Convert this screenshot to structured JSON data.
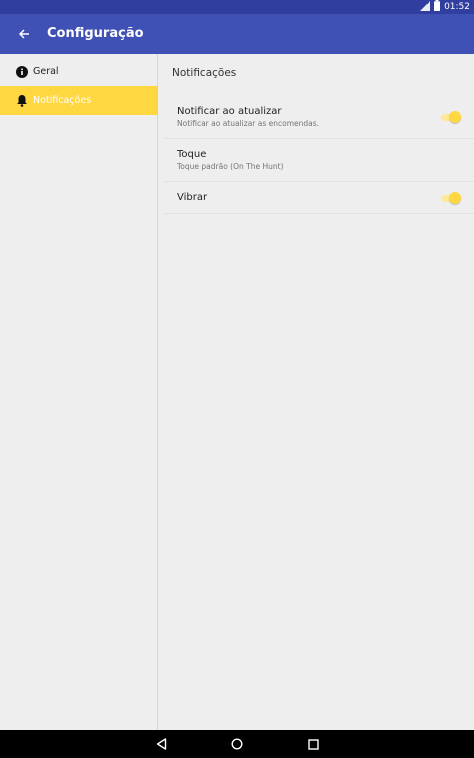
{
  "status_bar": {
    "time": "01:52",
    "icons": [
      "signal-icon",
      "battery-icon"
    ]
  },
  "app_bar": {
    "title": "Configuração",
    "back_icon": "arrow-back-icon"
  },
  "sidebar": {
    "items": [
      {
        "label": "Geral",
        "icon": "info-icon",
        "active": false
      },
      {
        "label": "Notificações",
        "icon": "bell-icon",
        "active": true
      }
    ]
  },
  "panel": {
    "title": "Notificações",
    "preferences": [
      {
        "title": "Notificar ao atualizar",
        "summary": "Notificar ao atualizar as encomendas.",
        "toggle": true
      },
      {
        "title": "Toque",
        "summary": "Toque padrão (On The Hunt)"
      },
      {
        "title": "Vibrar",
        "summary": "",
        "toggle": true
      }
    ]
  },
  "nav_bar": {
    "buttons": [
      "back-triangle-icon",
      "home-circle-icon",
      "recents-square-icon"
    ]
  },
  "colors": {
    "status_bar": "#303F9F",
    "app_bar": "#3F51B5",
    "accent": "#FFD740",
    "background": "#EEEEEE"
  }
}
